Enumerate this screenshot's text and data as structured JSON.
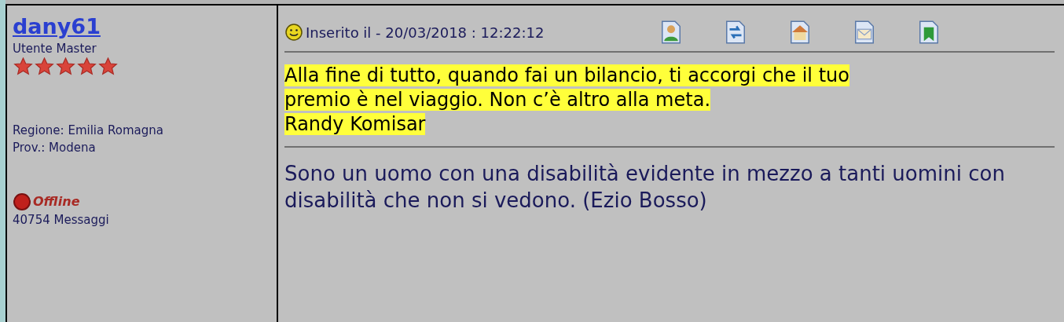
{
  "author": {
    "username": "dany61",
    "rank": "Utente Master",
    "stars": 5,
    "region": "Regione: Emilia Romagna",
    "province": "Prov.: Modena",
    "online": false,
    "status": "Offline",
    "messages": "40754 Messaggi"
  },
  "post": {
    "posted": "Inserito il - 20/03/2018 : 12:22:12",
    "actions": [
      {
        "kind": "profile"
      },
      {
        "kind": "quote"
      },
      {
        "kind": "home"
      },
      {
        "kind": "email"
      },
      {
        "kind": "bookmark"
      }
    ],
    "quote_lines": [
      "Alla fine di tutto, quando fai un bilancio, ti accorgi che il tuo",
      "premio è nel viaggio. Non c’è altro alla meta.",
      "Randy Komisar"
    ],
    "signature": "Sono un uomo con una disabilità evidente in mezzo a tanti uomini con disabilità che non si vedono. (Ezio Bosso)"
  }
}
